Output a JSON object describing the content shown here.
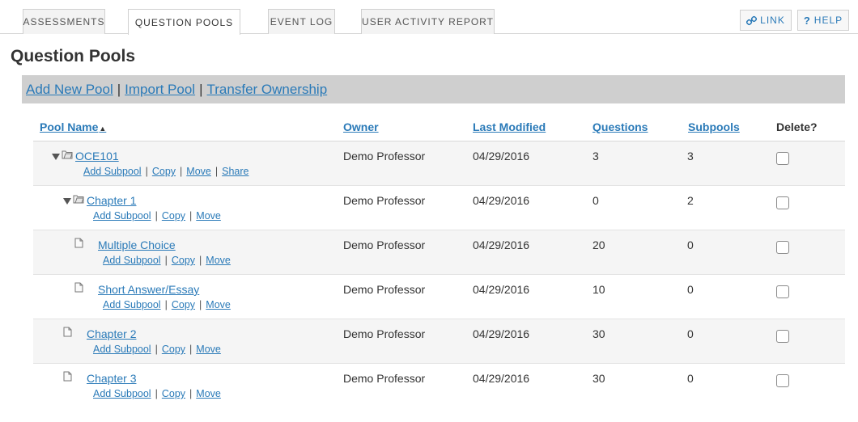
{
  "tabs": [
    {
      "label": "ASSESSMENTS",
      "active": false
    },
    {
      "label": "QUESTION POOLS",
      "active": true
    },
    {
      "label": "EVENT LOG",
      "active": false
    },
    {
      "label": "USER ACTIVITY REPORT",
      "active": false
    }
  ],
  "toolbar": {
    "link_label": "LINK",
    "help_label": "HELP",
    "help_symbol": "?"
  },
  "page": {
    "title": "Question Pools"
  },
  "actions": {
    "add_new_pool": "Add New Pool",
    "import_pool": "Import Pool",
    "transfer_ownership": "Transfer Ownership",
    "separator": "|"
  },
  "columns": {
    "pool_name": "Pool Name",
    "owner": "Owner",
    "last_modified": "Last Modified",
    "questions": "Questions",
    "subpools": "Subpools",
    "delete": "Delete?"
  },
  "row_action_labels": {
    "add_subpool": "Add Subpool",
    "copy": "Copy",
    "move": "Move",
    "share": "Share",
    "separator": "|"
  },
  "rows": [
    {
      "name": "OCE101",
      "owner": "Demo Professor",
      "last_modified": "04/29/2016",
      "questions": "3",
      "subpools": "3"
    },
    {
      "name": "Chapter 1",
      "owner": "Demo Professor",
      "last_modified": "04/29/2016",
      "questions": "0",
      "subpools": "2"
    },
    {
      "name": "Multiple Choice",
      "owner": "Demo Professor",
      "last_modified": "04/29/2016",
      "questions": "20",
      "subpools": "0"
    },
    {
      "name": "Short Answer/Essay",
      "owner": "Demo Professor",
      "last_modified": "04/29/2016",
      "questions": "10",
      "subpools": "0"
    },
    {
      "name": "Chapter 2",
      "owner": "Demo Professor",
      "last_modified": "04/29/2016",
      "questions": "30",
      "subpools": "0"
    },
    {
      "name": "Chapter 3",
      "owner": "Demo Professor",
      "last_modified": "04/29/2016",
      "questions": "30",
      "subpools": "0"
    }
  ],
  "colors": {
    "link": "#2a7ab8",
    "action_bar": "#cfcfcf",
    "row_alt": "#f5f5f5"
  }
}
